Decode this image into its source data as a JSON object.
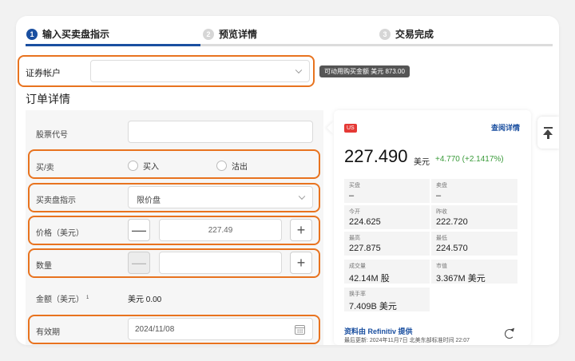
{
  "steps": [
    {
      "num": "1",
      "label": "输入买卖盘指示"
    },
    {
      "num": "2",
      "label": "预览详情"
    },
    {
      "num": "3",
      "label": "交易完成"
    }
  ],
  "account": {
    "label": "证券帐户",
    "value": "",
    "available_funds": "可动用购买金额  美元 873.00"
  },
  "order_title": "订单详情",
  "form": {
    "stock_code": {
      "label": "股票代号",
      "value": ""
    },
    "side": {
      "label": "买/卖",
      "buy": "买入",
      "sell": "沽出"
    },
    "order_type": {
      "label": "买卖盘指示",
      "value": "限价盘"
    },
    "price": {
      "label": "价格（美元）",
      "value": "227.49"
    },
    "quantity": {
      "label": "数量",
      "value": ""
    },
    "amount": {
      "label": "金额（美元）",
      "footnote": "1",
      "value": "美元 0.00"
    },
    "validity": {
      "label": "有效期",
      "value": "2024/11/08"
    }
  },
  "quote": {
    "market_badge": "US",
    "detail_link": "查阅详情",
    "price": "227.490",
    "currency": "美元",
    "change": "+4.770 (+2.1417%)",
    "stats": [
      {
        "label": "买盘",
        "value": "–"
      },
      {
        "label": "卖盘",
        "value": "–"
      },
      {
        "label": "今开",
        "value": "224.625"
      },
      {
        "label": "昨收",
        "value": "222.720"
      },
      {
        "label": "最高",
        "value": "227.875"
      },
      {
        "label": "最低",
        "value": "224.570"
      },
      {
        "label": "成交量",
        "value": "42.14M 股"
      },
      {
        "label": "市值",
        "value": "3.367M 美元"
      },
      {
        "label": "换手率",
        "value": "7.409B 美元"
      }
    ],
    "source": "资料由 Refinitiv 提供",
    "updated": "最后更新:  2024年11月7日 北美东部标准时间 22:07"
  },
  "colors": {
    "accent": "#1a4fa0",
    "highlight": "#e8731f",
    "positive": "#3a9b3a",
    "badge": "#e53935"
  }
}
